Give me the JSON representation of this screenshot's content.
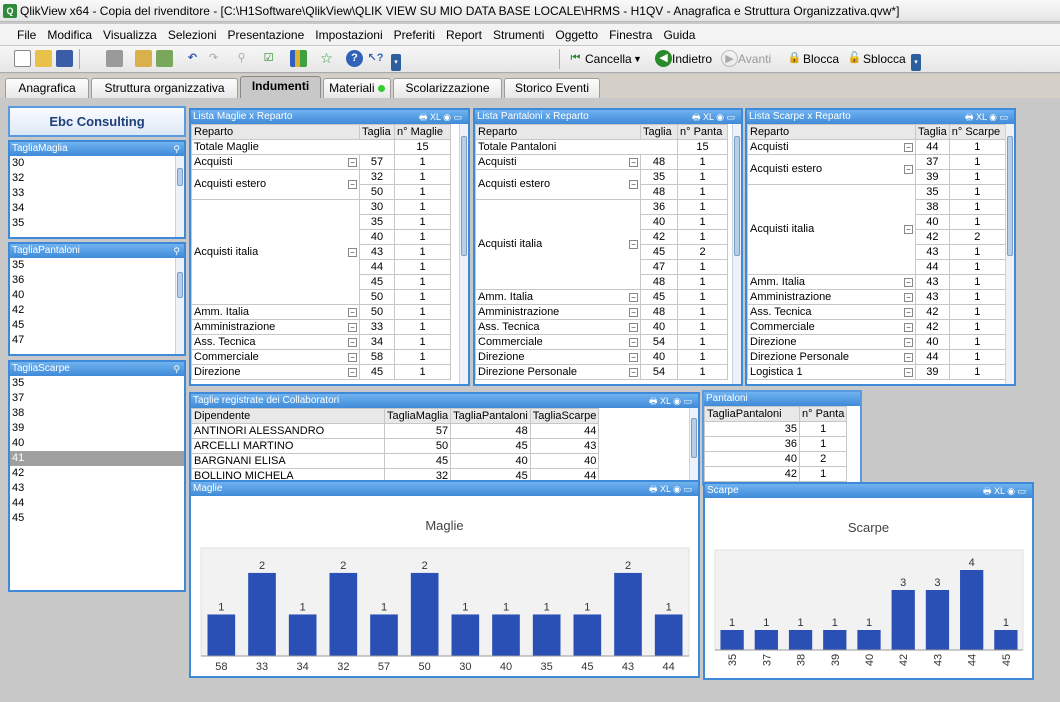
{
  "app": {
    "title": "QlikView x64 - Copia del rivenditore - [C:\\H1Software\\QlikView\\QLIK VIEW SU MIO DATA BASE LOCALE\\HRMS - H1QV - Anagrafica e Struttura Organizzativa.qvw*]"
  },
  "menu": [
    "File",
    "Modifica",
    "Visualizza",
    "Selezioni",
    "Presentazione",
    "Impostazioni",
    "Preferiti",
    "Report",
    "Strumenti",
    "Oggetto",
    "Finestra",
    "Guida"
  ],
  "toolbar": {
    "clear": "Cancella",
    "back": "Indietro",
    "forward": "Avanti",
    "lock": "Blocca",
    "unlock": "Sblocca"
  },
  "tabs": [
    "Anagrafica",
    "Struttura organizzativa",
    "Indumenti",
    "Materiali",
    "Scolarizzazione",
    "Storico Eventi"
  ],
  "company": "Ebc Consulting",
  "lists": {
    "maglia": {
      "title": "TagliaMaglia",
      "items": [
        "30",
        "32",
        "33",
        "34",
        "35"
      ]
    },
    "pantaloni": {
      "title": "TagliaPantaloni",
      "items": [
        "35",
        "36",
        "40",
        "42",
        "45",
        "47"
      ]
    },
    "scarpe": {
      "title": "TagliaScarpe",
      "items": [
        "35",
        "37",
        "38",
        "39",
        "40",
        "41",
        "42",
        "43",
        "44",
        "45"
      ],
      "selected": "41"
    }
  },
  "pivot_maglie": {
    "title": "Lista Maglie x Reparto",
    "headers": [
      "Reparto",
      "Taglia",
      "n° Maglie"
    ],
    "total_label": "Totale Maglie",
    "total": "15",
    "rows": [
      [
        "Acquisti",
        "57",
        "1"
      ],
      [
        "Acquisti estero",
        "32",
        "1"
      ],
      [
        "",
        "50",
        "1"
      ],
      [
        "Acquisti italia",
        "30",
        "1"
      ],
      [
        "",
        "35",
        "1"
      ],
      [
        "",
        "40",
        "1"
      ],
      [
        "",
        "43",
        "1"
      ],
      [
        "",
        "44",
        "1"
      ],
      [
        "",
        "45",
        "1"
      ],
      [
        "",
        "50",
        "1"
      ],
      [
        "Amm. Italia",
        "50",
        "1"
      ],
      [
        "Amministrazione",
        "33",
        "1"
      ],
      [
        "Ass. Tecnica",
        "34",
        "1"
      ],
      [
        "Commerciale",
        "58",
        "1"
      ],
      [
        "Direzione",
        "45",
        "1"
      ]
    ]
  },
  "pivot_pantaloni": {
    "title": "Lista Pantaloni x Reparto",
    "headers": [
      "Reparto",
      "Taglia",
      "n° Panta"
    ],
    "total_label": "Totale Pantaloni",
    "total": "15",
    "rows": [
      [
        "Acquisti",
        "48",
        "1"
      ],
      [
        "Acquisti estero",
        "35",
        "1"
      ],
      [
        "",
        "48",
        "1"
      ],
      [
        "Acquisti italia",
        "36",
        "1"
      ],
      [
        "",
        "40",
        "1"
      ],
      [
        "",
        "42",
        "1"
      ],
      [
        "",
        "45",
        "2"
      ],
      [
        "",
        "47",
        "1"
      ],
      [
        "",
        "48",
        "1"
      ],
      [
        "Amm. Italia",
        "45",
        "1"
      ],
      [
        "Amministrazione",
        "48",
        "1"
      ],
      [
        "Ass. Tecnica",
        "40",
        "1"
      ],
      [
        "Commerciale",
        "54",
        "1"
      ],
      [
        "Direzione",
        "40",
        "1"
      ],
      [
        "Direzione Personale",
        "54",
        "1"
      ]
    ]
  },
  "pivot_scarpe": {
    "title": "Lista Scarpe x Reparto",
    "headers": [
      "Reparto",
      "Taglia",
      "n° Scarpe"
    ],
    "rows": [
      [
        "Acquisti",
        "44",
        "1"
      ],
      [
        "Acquisti estero",
        "37",
        "1"
      ],
      [
        "",
        "39",
        "1"
      ],
      [
        "Acquisti italia",
        "35",
        "1"
      ],
      [
        "",
        "38",
        "1"
      ],
      [
        "",
        "40",
        "1"
      ],
      [
        "",
        "42",
        "2"
      ],
      [
        "",
        "43",
        "1"
      ],
      [
        "",
        "44",
        "1"
      ],
      [
        "Amm. Italia",
        "43",
        "1"
      ],
      [
        "Amministrazione",
        "43",
        "1"
      ],
      [
        "Ass. Tecnica",
        "42",
        "1"
      ],
      [
        "Commerciale",
        "42",
        "1"
      ],
      [
        "Direzione",
        "40",
        "1"
      ],
      [
        "Direzione Personale",
        "44",
        "1"
      ],
      [
        "Logistica 1",
        "39",
        "1"
      ]
    ]
  },
  "collab": {
    "title": "Taglie registrate dei Collaboratori",
    "headers": [
      "Dipendente",
      "TagliaMaglia",
      "TagliaPantaloni",
      "TagliaScarpe"
    ],
    "rows": [
      [
        "ANTINORI ALESSANDRO",
        "57",
        "48",
        "44"
      ],
      [
        "ARCELLI MARTINO",
        "50",
        "45",
        "43"
      ],
      [
        "BARGNANI ELISA",
        "45",
        "40",
        "40"
      ],
      [
        "BOLLINO MICHELA",
        "32",
        "45",
        "44"
      ]
    ]
  },
  "pantaloni_tbl": {
    "title": "Pantaloni",
    "headers": [
      "TagliaPantaloni",
      "n° Panta"
    ],
    "rows": [
      [
        "35",
        "1"
      ],
      [
        "36",
        "1"
      ],
      [
        "40",
        "2"
      ],
      [
        "42",
        "1"
      ]
    ]
  },
  "chart_maglie": {
    "caption": "Maglie",
    "chart_data": {
      "type": "bar",
      "title": "Maglie",
      "categories": [
        "58",
        "33",
        "34",
        "32",
        "57",
        "50",
        "30",
        "40",
        "35",
        "45",
        "43",
        "44"
      ],
      "values": [
        1,
        2,
        1,
        2,
        1,
        2,
        1,
        1,
        1,
        1,
        2,
        1
      ],
      "ylim": [
        0,
        2.6
      ]
    }
  },
  "chart_scarpe": {
    "caption": "Scarpe",
    "chart_data": {
      "type": "bar",
      "title": "Scarpe",
      "categories": [
        "35",
        "37",
        "38",
        "39",
        "40",
        "42",
        "43",
        "44",
        "45"
      ],
      "values": [
        1,
        1,
        1,
        1,
        1,
        3,
        3,
        4,
        1
      ],
      "ylim": [
        0,
        5
      ]
    }
  },
  "colors": {
    "caption": "#3f8ad8",
    "bar": "#2a4fb5"
  }
}
